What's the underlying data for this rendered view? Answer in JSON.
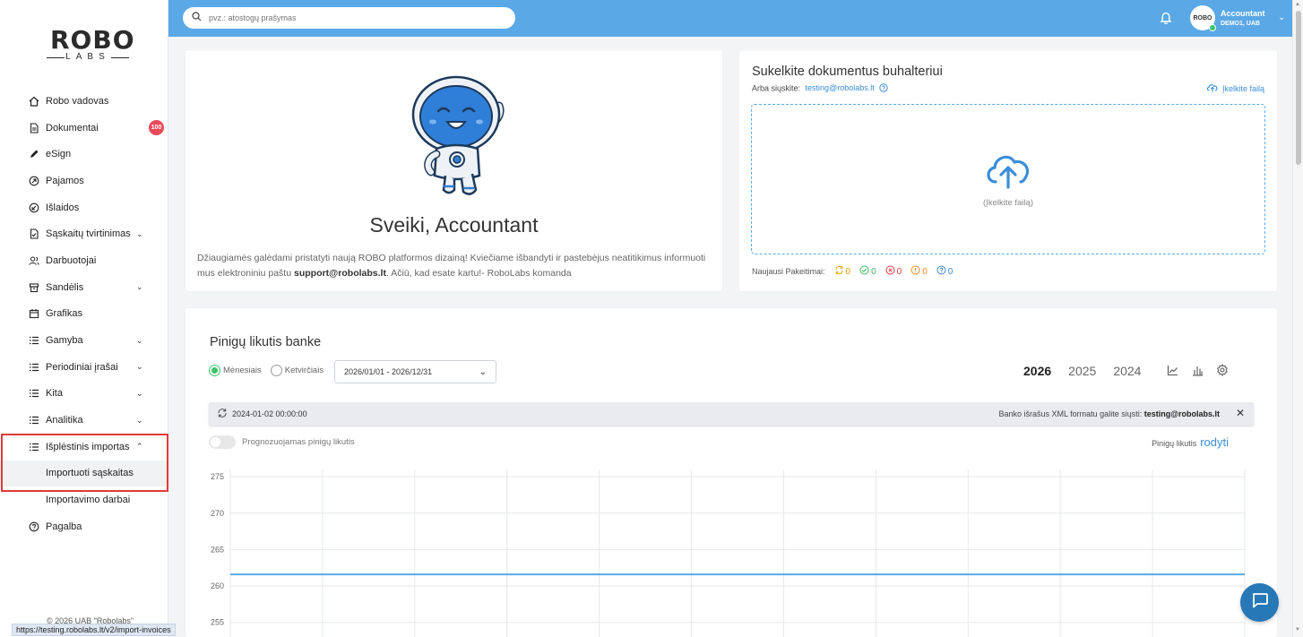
{
  "app": {
    "logo_top": "ROBO",
    "logo_bottom": "LABS"
  },
  "sidebar": {
    "items": [
      {
        "label": "Robo vadovas",
        "icon": "home-icon"
      },
      {
        "label": "Dokumentai",
        "icon": "document-icon",
        "badge": "100"
      },
      {
        "label": "eSign",
        "icon": "pen-icon"
      },
      {
        "label": "Pajamos",
        "icon": "income-icon"
      },
      {
        "label": "Išlaidos",
        "icon": "expense-icon"
      },
      {
        "label": "Sąskaitų tvirtinimas",
        "icon": "invoice-check-icon",
        "expandable": true
      },
      {
        "label": "Darbuotojai",
        "icon": "people-icon"
      },
      {
        "label": "Sandėlis",
        "icon": "warehouse-icon",
        "expandable": true
      },
      {
        "label": "Grafikas",
        "icon": "calendar-icon"
      },
      {
        "label": "Gamyba",
        "icon": "list-icon",
        "expandable": true
      },
      {
        "label": "Periodiniai įrašai",
        "icon": "list-icon",
        "expandable": true
      },
      {
        "label": "Kita",
        "icon": "list-icon",
        "expandable": true
      },
      {
        "label": "Analitika",
        "icon": "list-icon",
        "expandable": true
      },
      {
        "label": "Išplėstinis importas",
        "icon": "list-icon",
        "expanded": true
      }
    ],
    "sub_items": [
      {
        "label": "Importuoti sąskaitas",
        "active": true
      },
      {
        "label": "Importavimo darbai"
      }
    ],
    "help": {
      "label": "Pagalba",
      "icon": "help-icon"
    },
    "copyright": "© 2026 UAB \"Robolabs\"",
    "status_url": "https://testing.robolabs.lt/v2/import-invoices"
  },
  "topbar": {
    "search_placeholder": "pvz.: atostogų prašymas",
    "avatar_text": "ROBO",
    "user_name": "Accountant",
    "user_company": "DEMO1, UAB"
  },
  "welcome": {
    "title": "Sveiki, Accountant",
    "text_before": "Džiaugiamės galėdami pristatyti naują ROBO platformos dizainą! Kviečiame išbandyti ir pastebėjus neatitikimus informuoti mus elektroniniu paštu ",
    "email": "support@robolabs.lt",
    "text_after": ". Ačiū, kad esate kartu!- RoboLabs komanda"
  },
  "upload": {
    "title": "Sukelkite dokumentus buhalteriui",
    "send_label": "Arba siųskite:",
    "email": "testing@robolabs.lt",
    "upload_link": "Įkelkite failą",
    "drop_label": "(Įkelkite failą)",
    "changes_label": "Naujausi Pakeitimai:",
    "changes": [
      {
        "icon": "sync-icon",
        "value": "0",
        "color": "#e3a008"
      },
      {
        "icon": "check-circle-icon",
        "value": "0",
        "color": "#3cb55b"
      },
      {
        "icon": "x-circle-icon",
        "value": "0",
        "color": "#e23a3a"
      },
      {
        "icon": "alert-circle-icon",
        "value": "0",
        "color": "#f08a24"
      },
      {
        "icon": "question-circle-icon",
        "value": "0",
        "color": "#3a8ed8"
      }
    ]
  },
  "bank": {
    "title": "Pinigų likutis banke",
    "radio_monthly": "Mėnesiais",
    "radio_quarterly": "Ketvirčiais",
    "date_range": "2026/01/01 - 2026/12/31",
    "years": [
      "2026",
      "2025",
      "2024"
    ],
    "active_year": "2026",
    "sync_time": "2024-01-02 00:00:00",
    "xml_text": "Banko išrašus XML formatu galite siųsti:",
    "xml_email": "testing@robolabs.lt",
    "forecast_label": "Prognozuojamas pinigų likutis",
    "balance_label": "Pinigų likutis",
    "balance_link": "rodyti"
  },
  "chart_data": {
    "type": "line",
    "y_ticks": [
      "275",
      "270",
      "265",
      "260",
      "255"
    ],
    "ylim": [
      253,
      276
    ],
    "x_count": 12,
    "series": [
      {
        "values": [
          261.6,
          261.6,
          261.6,
          261.6,
          261.6,
          261.6,
          261.6,
          261.6,
          261.6,
          261.6,
          261.6,
          261.6
        ]
      }
    ],
    "line_color": "#5aa8e6",
    "grid": true
  }
}
